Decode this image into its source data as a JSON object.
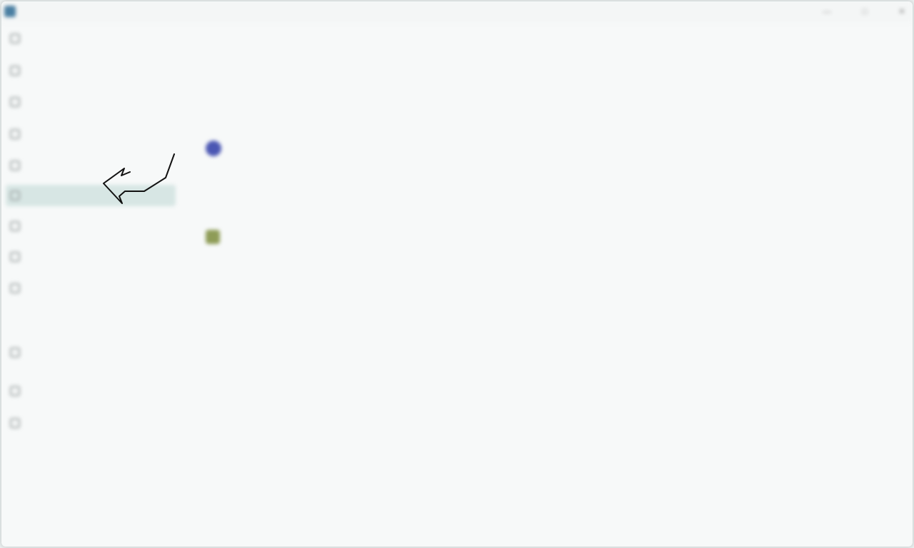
{
  "window": {
    "title": ""
  },
  "sidebar": {
    "items": [
      {
        "label": "",
        "badge": ""
      },
      {
        "label": "",
        "badge": ""
      },
      {
        "label": "",
        "badge": ""
      },
      {
        "label": "",
        "badge": ""
      },
      {
        "label": "",
        "badge": ""
      },
      {
        "label": "",
        "badge": "",
        "selected": true
      },
      {
        "label": "",
        "badge": ""
      },
      {
        "label": "",
        "badge": ""
      },
      {
        "label": "",
        "badge": ""
      }
    ],
    "section_label": "",
    "footer_items": [
      {
        "label": ""
      },
      {
        "label": ""
      },
      {
        "label": ""
      }
    ]
  },
  "main": {
    "heading": "",
    "section_title_emph": "",
    "section_title_rest": "",
    "description": "",
    "description_link": "",
    "account": {
      "name": "",
      "subtext": ""
    },
    "sub_heading": "",
    "item_label": ""
  },
  "icons": [
    "app-icon",
    "minimize-icon",
    "maximize-icon",
    "close-icon",
    "account-avatar-icon",
    "item-icon",
    "arrow-annotation-icon"
  ],
  "colors": {
    "accent": "#2f8b8d",
    "selected_bg": "#d7e6e4",
    "avatar": "#4b57b3",
    "item_icon": "#8e9c57"
  }
}
